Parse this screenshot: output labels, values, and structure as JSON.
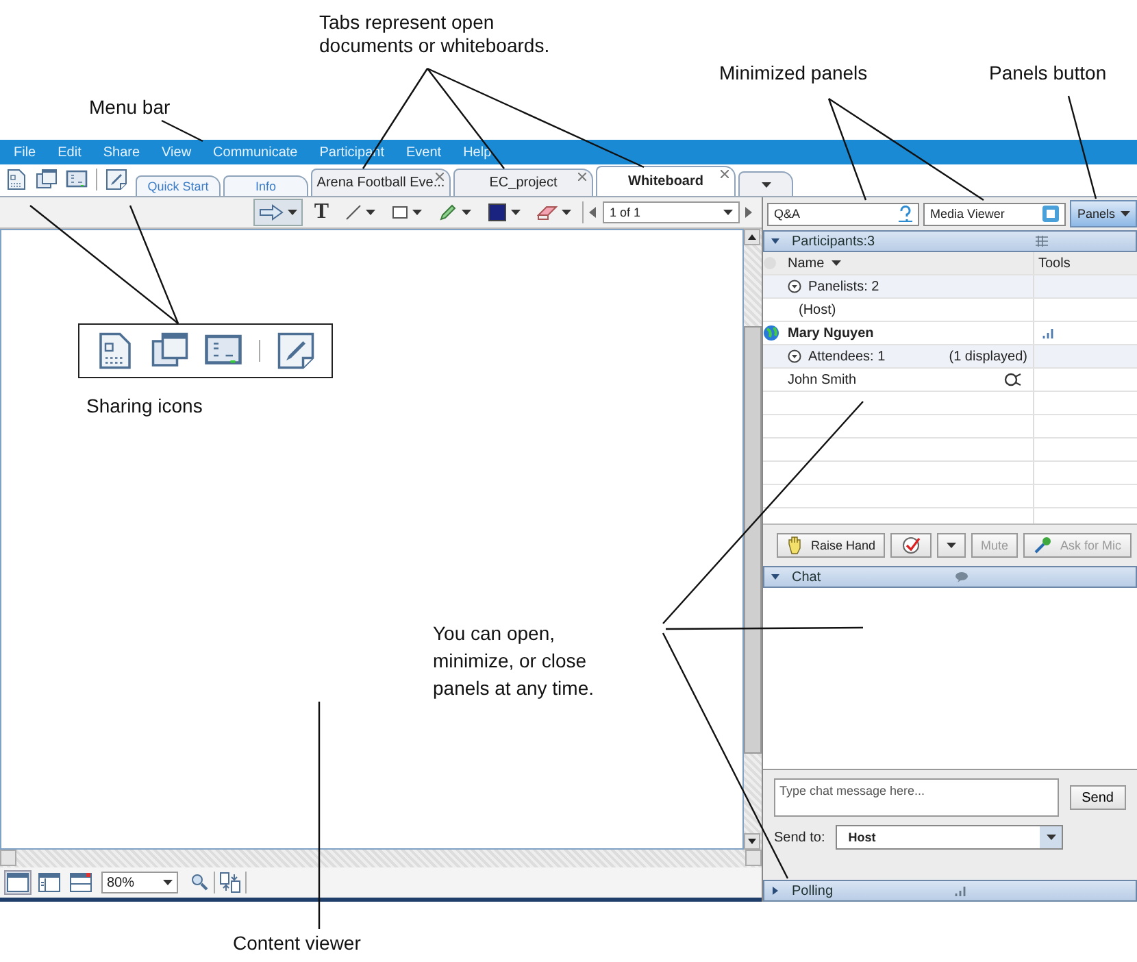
{
  "callouts": {
    "menu_bar": "Menu bar",
    "tabs": "Tabs represent open documents or whiteboards.",
    "minimized_panels": "Minimized panels",
    "panels_button": "Panels button",
    "sharing_icons": "Sharing icons",
    "panels_note": "You can open, minimize, or close panels at any time.",
    "content_viewer": "Content viewer"
  },
  "menu_bar": [
    "File",
    "Edit",
    "Share",
    "View",
    "Communicate",
    "Participant",
    "Event",
    "Help"
  ],
  "tabs": [
    {
      "kind": "nav",
      "label": "Quick Start",
      "selected": false
    },
    {
      "kind": "nav",
      "label": "Info",
      "selected": false
    },
    {
      "kind": "document",
      "label": "Arena Football Eve...",
      "selected": false
    },
    {
      "kind": "document",
      "label": "EC_project",
      "selected": false
    },
    {
      "kind": "document",
      "label": "Whiteboard",
      "selected": true
    },
    {
      "kind": "menu",
      "selected": false
    }
  ],
  "tools": [
    {
      "kind": "pointer",
      "selected": true,
      "menu": true
    },
    {
      "kind": "text",
      "label": "T",
      "selected": false,
      "menu": false
    },
    {
      "kind": "line",
      "selected": false,
      "menu": true
    },
    {
      "kind": "rect",
      "selected": false,
      "menu": true
    },
    {
      "kind": "pen",
      "selected": false,
      "menu": true
    },
    {
      "kind": "color",
      "selected": false,
      "menu": true
    },
    {
      "kind": "eraser",
      "selected": false,
      "menu": true
    }
  ],
  "page_select": "1 of 1",
  "views": [
    {
      "kind": "single",
      "selected": true
    },
    {
      "kind": "split",
      "selected": false
    },
    {
      "kind": "thumbs",
      "selected": false
    }
  ],
  "zoom": "80%",
  "minimized_panels": [
    {
      "kind": "qa",
      "label": "Q&A"
    },
    {
      "kind": "media",
      "label": "Media Viewer"
    }
  ],
  "panels_button": "Panels",
  "participants": {
    "title": "Participants:3",
    "expanded": true,
    "columns": [
      "Name",
      "Tools"
    ],
    "rows": [
      {
        "kind": "group",
        "label": "Panelists: 2"
      },
      {
        "kind": "role",
        "label": "(Host)"
      },
      {
        "kind": "presenter",
        "label": "Mary Nguyen"
      },
      {
        "kind": "group",
        "label": "Attendees: 1",
        "note": "(1 displayed)"
      },
      {
        "kind": "attendee",
        "label": "John Smith"
      }
    ]
  },
  "actions": [
    {
      "kind": "raise",
      "label": "Raise Hand",
      "disabled": false
    },
    {
      "kind": "feedback"
    },
    {
      "kind": "menu"
    },
    {
      "kind": "mute",
      "label": "Mute",
      "disabled": true
    },
    {
      "kind": "mic",
      "label": "Ask for Mic",
      "disabled": true
    }
  ],
  "chat": {
    "title": "Chat",
    "expanded": true,
    "placeholder": "Type chat message here...",
    "send": "Send",
    "send_to_label": "Send to:",
    "send_to": "Host"
  },
  "polling": {
    "title": "Polling",
    "expanded": false
  }
}
